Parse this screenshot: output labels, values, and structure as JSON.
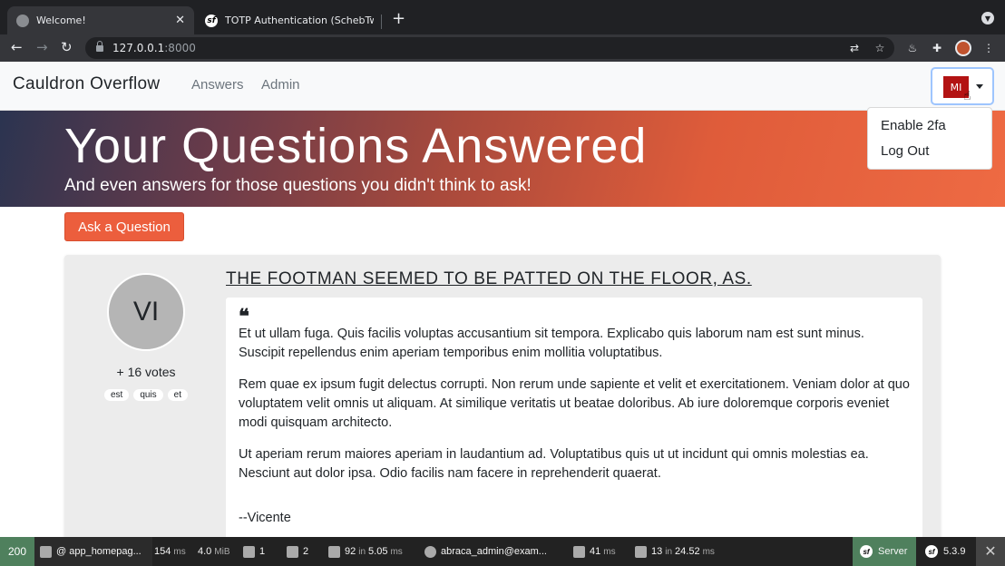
{
  "browser": {
    "tabs": [
      {
        "title": "Welcome!",
        "close": "✕"
      },
      {
        "title": "TOTP Authentication (SchebTw",
        "close": ""
      }
    ],
    "new_tab": "+",
    "url_host": "127.0.0.1",
    "url_port": ":8000"
  },
  "navbar": {
    "brand": "Cauldron Overflow",
    "links": [
      "Answers",
      "Admin"
    ],
    "user_initials": "MI"
  },
  "dropdown": {
    "items": [
      "Enable 2fa",
      "Log Out"
    ]
  },
  "hero": {
    "title": "Your Questions Answered",
    "subtitle": "And even answers for those questions you didn't think to ask!"
  },
  "ask_button": "Ask a Question",
  "question": {
    "avatar_initials": "VI",
    "votes": "+ 16 votes",
    "tags": [
      "est",
      "quis",
      "et"
    ],
    "title": "THE FOOTMAN SEEMED TO BE PATTED ON THE FLOOR, AS.",
    "quote_mark": "❝",
    "paragraphs": [
      "Et ut ullam fuga. Quis facilis voluptas accusantium sit tempora. Explicabo quis laborum nam est sunt minus. Suscipit repellendus enim aperiam temporibus enim mollitia voluptatibus.",
      "Rem quae ex ipsum fugit delectus corrupti. Non rerum unde sapiente et velit et exercitationem. Veniam dolor at quo voluptatem velit omnis ut aliquam. At similique veritatis ut beatae doloribus. Ab iure doloremque corporis eveniet modi quisquam architecto.",
      "Ut aperiam rerum maiores aperiam in laudantium ad. Voluptatibus quis ut ut incidunt qui omnis molestias ea. Nesciunt aut dolor ipsa. Odio facilis nam facere in reprehenderit quaerat."
    ],
    "signature": "--Vicente"
  },
  "debug_toolbar": {
    "status": "200",
    "route": "@ app_homepag...",
    "time": "154",
    "time_unit": "ms",
    "memory": "4.0",
    "memory_unit": "MiB",
    "forms": "1",
    "translations": "2",
    "doctrine_queries": "92",
    "doctrine_in": "in",
    "doctrine_time": "5.05",
    "doctrine_unit": "ms",
    "user": "abraca_admin@exam...",
    "twig_time": "41",
    "twig_unit": "ms",
    "cache_calls": "13",
    "cache_in": "in",
    "cache_time": "24.52",
    "cache_unit": "ms",
    "server": "Server",
    "version": "5.3.9",
    "close": "✕"
  }
}
